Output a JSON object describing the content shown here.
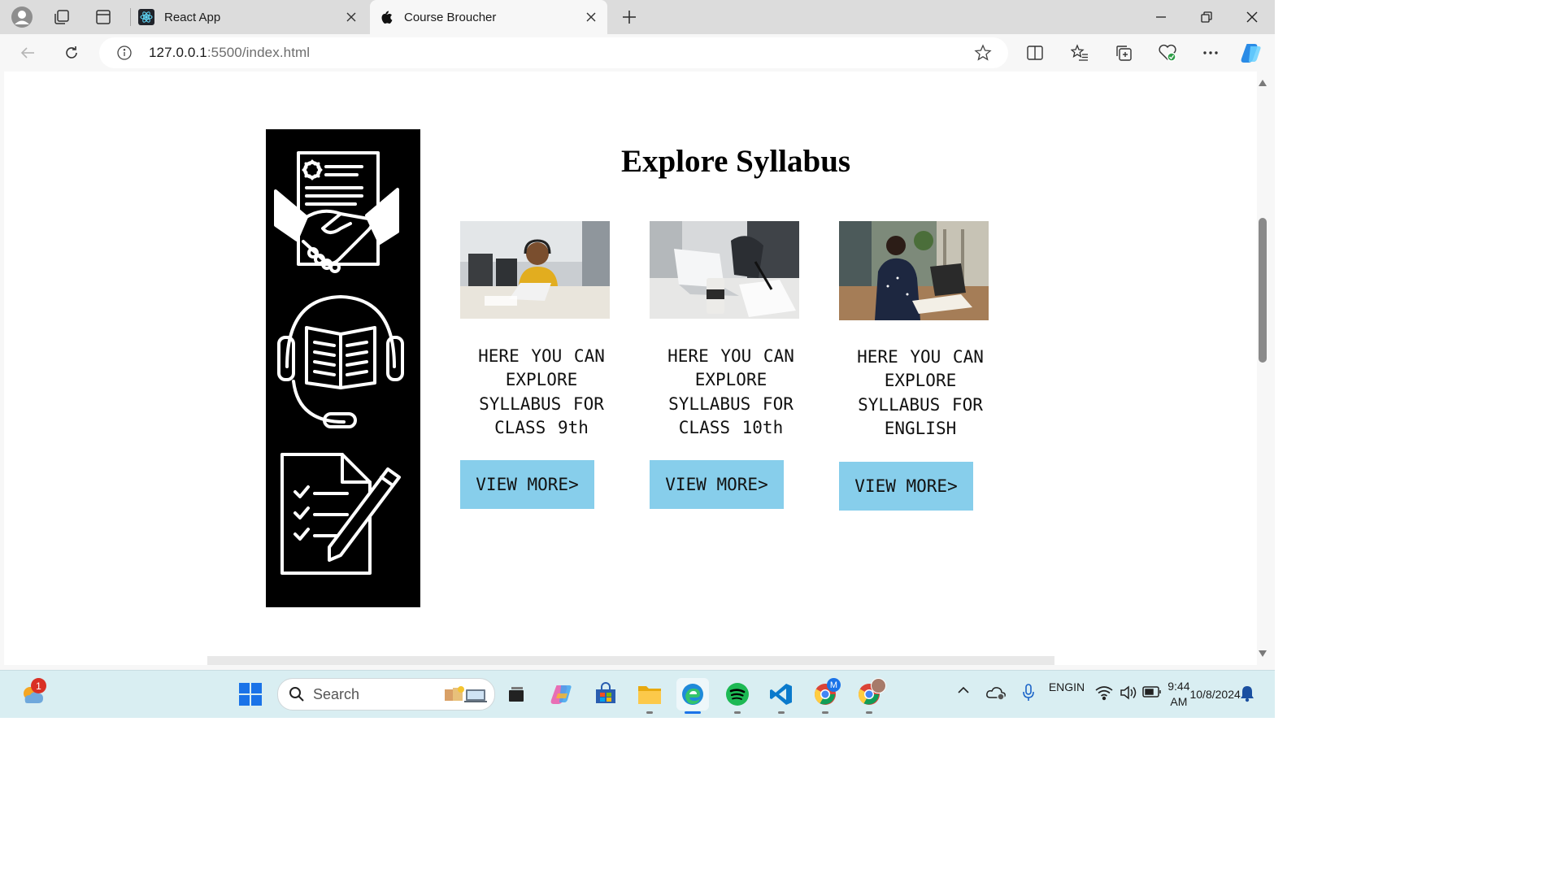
{
  "browser": {
    "tabs": [
      {
        "title": "React App",
        "active": false
      },
      {
        "title": "Course Broucher",
        "active": true
      }
    ],
    "url_host": "127.0.0.1",
    "url_rest": ":5500/index.html"
  },
  "page": {
    "heading": "Explore Syllabus",
    "cards": [
      {
        "text": "HERE YOU CAN EXPLORE SYLLABUS FOR CLASS 9th",
        "button": "VIEW MORE>"
      },
      {
        "text": "HERE YOU CAN EXPLORE SYLLABUS FOR CLASS 10th",
        "button": "VIEW MORE>"
      },
      {
        "text": "HERE YOU CAN EXPLORE SYLLABUS FOR ENGLISH",
        "button": "VIEW MORE>"
      }
    ],
    "button_color": "#87ceeb"
  },
  "taskbar": {
    "search_placeholder": "Search",
    "weather_badge": "1",
    "language_line1": "ENG",
    "language_line2": "IN",
    "time": "9:44 AM",
    "date": "10/8/2024",
    "chrome_profile_badge": "M"
  }
}
